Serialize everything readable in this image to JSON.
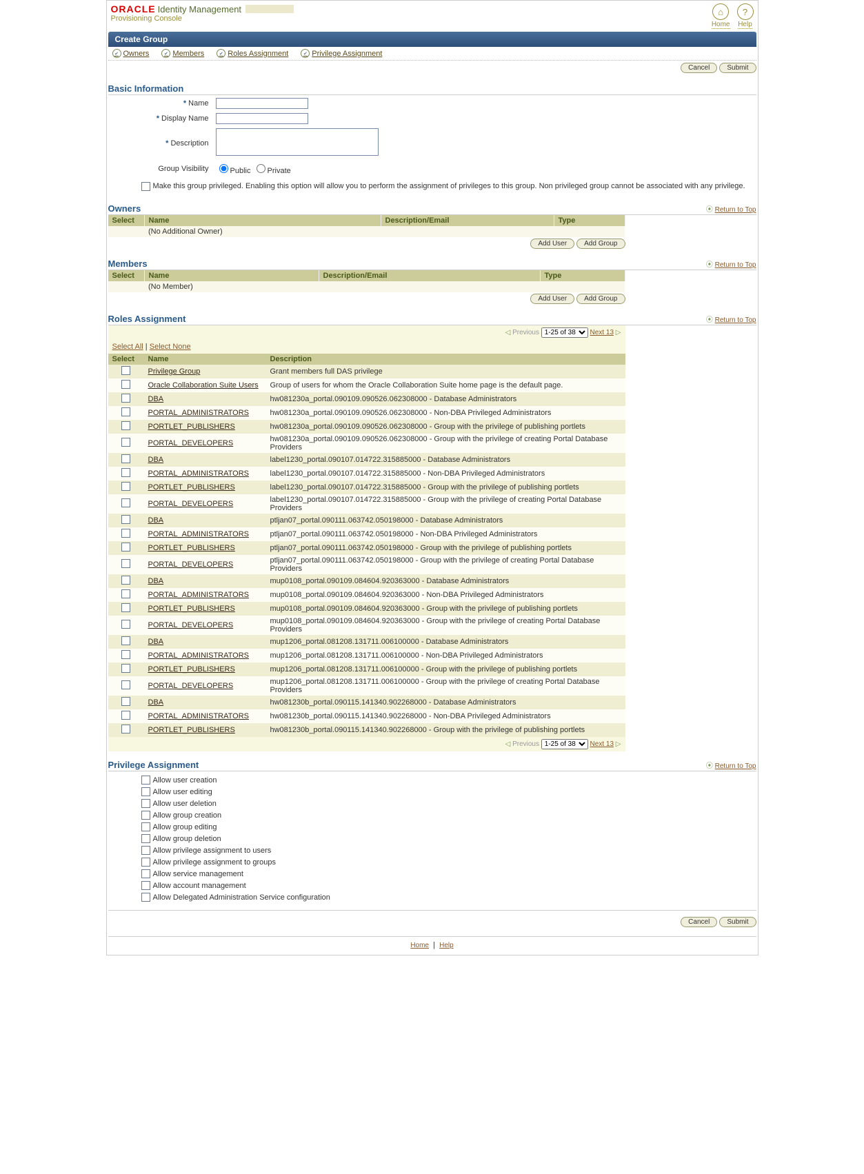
{
  "header": {
    "brand": "ORACLE",
    "product": "Identity Management",
    "console": "Provisioning Console",
    "links": {
      "home": "Home",
      "help": "Help"
    }
  },
  "page_title": "Create Group",
  "nav": [
    "Owners",
    "Members",
    "Roles Assignment",
    "Privilege Assignment"
  ],
  "buttons": {
    "cancel": "Cancel",
    "submit": "Submit",
    "add_user": "Add User",
    "add_group": "Add Group"
  },
  "basic": {
    "heading": "Basic Information",
    "name_lbl": "Name",
    "display_lbl": "Display Name",
    "desc_lbl": "Description",
    "vis_lbl": "Group Visibility",
    "vis_public": "Public",
    "vis_private": "Private",
    "priv_note": "Make this group privileged. Enabling this option will allow you to perform the assignment of privileges to this group. Non privileged group cannot be associated with any privilege."
  },
  "owners": {
    "heading": "Owners",
    "cols": {
      "select": "Select",
      "name": "Name",
      "desc": "Description/Email",
      "type": "Type"
    },
    "empty": "(No Additional Owner)"
  },
  "members": {
    "heading": "Members",
    "cols": {
      "select": "Select",
      "name": "Name",
      "desc": "Description/Email",
      "type": "Type"
    },
    "empty": "(No Member)"
  },
  "roles": {
    "heading": "Roles Assignment",
    "pager": {
      "prev": "Previous",
      "range": "1-25 of 38",
      "next": "Next 13"
    },
    "select_all": "Select All",
    "select_none": "Select None",
    "cols": {
      "select": "Select",
      "name": "Name",
      "desc": "Description"
    },
    "rows": [
      {
        "name": "Privilege Group",
        "desc": "Grant members full DAS privilege"
      },
      {
        "name": "Oracle Collaboration Suite Users",
        "desc": "Group of users for whom the Oracle Collaboration Suite home page is the default page."
      },
      {
        "name": "DBA",
        "desc": "hw081230a_portal.090109.090526.062308000 - Database Administrators"
      },
      {
        "name": "PORTAL_ADMINISTRATORS",
        "desc": "hw081230a_portal.090109.090526.062308000 - Non-DBA Privileged Administrators"
      },
      {
        "name": "PORTLET_PUBLISHERS",
        "desc": "hw081230a_portal.090109.090526.062308000 - Group with the privilege of publishing portlets"
      },
      {
        "name": "PORTAL_DEVELOPERS",
        "desc": "hw081230a_portal.090109.090526.062308000 - Group with the privilege of creating Portal Database Providers"
      },
      {
        "name": "DBA",
        "desc": "label1230_portal.090107.014722.315885000 - Database Administrators"
      },
      {
        "name": "PORTAL_ADMINISTRATORS",
        "desc": "label1230_portal.090107.014722.315885000 - Non-DBA Privileged Administrators"
      },
      {
        "name": "PORTLET_PUBLISHERS",
        "desc": "label1230_portal.090107.014722.315885000 - Group with the privilege of publishing portlets"
      },
      {
        "name": "PORTAL_DEVELOPERS",
        "desc": "label1230_portal.090107.014722.315885000 - Group with the privilege of creating Portal Database Providers"
      },
      {
        "name": "DBA",
        "desc": "ptljan07_portal.090111.063742.050198000 - Database Administrators"
      },
      {
        "name": "PORTAL_ADMINISTRATORS",
        "desc": "ptljan07_portal.090111.063742.050198000 - Non-DBA Privileged Administrators"
      },
      {
        "name": "PORTLET_PUBLISHERS",
        "desc": "ptljan07_portal.090111.063742.050198000 - Group with the privilege of publishing portlets"
      },
      {
        "name": "PORTAL_DEVELOPERS",
        "desc": "ptljan07_portal.090111.063742.050198000 - Group with the privilege of creating Portal Database Providers"
      },
      {
        "name": "DBA",
        "desc": "mup0108_portal.090109.084604.920363000 - Database Administrators"
      },
      {
        "name": "PORTAL_ADMINISTRATORS",
        "desc": "mup0108_portal.090109.084604.920363000 - Non-DBA Privileged Administrators"
      },
      {
        "name": "PORTLET_PUBLISHERS",
        "desc": "mup0108_portal.090109.084604.920363000 - Group with the privilege of publishing portlets"
      },
      {
        "name": "PORTAL_DEVELOPERS",
        "desc": "mup0108_portal.090109.084604.920363000 - Group with the privilege of creating Portal Database Providers"
      },
      {
        "name": "DBA",
        "desc": "mup1206_portal.081208.131711.006100000 - Database Administrators"
      },
      {
        "name": "PORTAL_ADMINISTRATORS",
        "desc": "mup1206_portal.081208.131711.006100000 - Non-DBA Privileged Administrators"
      },
      {
        "name": "PORTLET_PUBLISHERS",
        "desc": "mup1206_portal.081208.131711.006100000 - Group with the privilege of publishing portlets"
      },
      {
        "name": "PORTAL_DEVELOPERS",
        "desc": "mup1206_portal.081208.131711.006100000 - Group with the privilege of creating Portal Database Providers"
      },
      {
        "name": "DBA",
        "desc": "hw081230b_portal.090115.141340.902268000 - Database Administrators"
      },
      {
        "name": "PORTAL_ADMINISTRATORS",
        "desc": "hw081230b_portal.090115.141340.902268000 - Non-DBA Privileged Administrators"
      },
      {
        "name": "PORTLET_PUBLISHERS",
        "desc": "hw081230b_portal.090115.141340.902268000 - Group with the privilege of publishing portlets"
      }
    ]
  },
  "privileges": {
    "heading": "Privilege Assignment",
    "items": [
      "Allow user creation",
      "Allow user editing",
      "Allow user deletion",
      "Allow group creation",
      "Allow group editing",
      "Allow group deletion",
      "Allow privilege assignment to users",
      "Allow privilege assignment to groups",
      "Allow service management",
      "Allow account management",
      "Allow Delegated Administration Service configuration"
    ]
  },
  "return_to_top": "Return to Top",
  "footer": {
    "home": "Home",
    "help": "Help"
  }
}
